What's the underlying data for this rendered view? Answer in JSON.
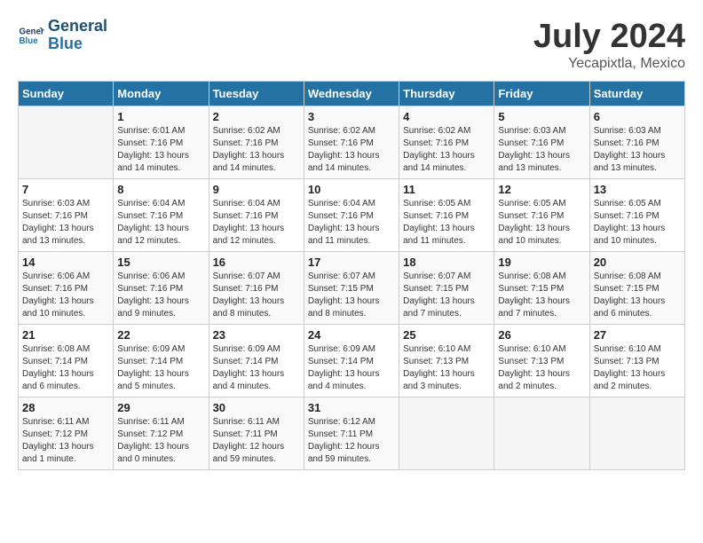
{
  "header": {
    "logo_line1": "General",
    "logo_line2": "Blue",
    "month": "July 2024",
    "location": "Yecapixtla, Mexico"
  },
  "columns": [
    "Sunday",
    "Monday",
    "Tuesday",
    "Wednesday",
    "Thursday",
    "Friday",
    "Saturday"
  ],
  "weeks": [
    [
      {
        "day": "",
        "info": ""
      },
      {
        "day": "1",
        "info": "Sunrise: 6:01 AM\nSunset: 7:16 PM\nDaylight: 13 hours\nand 14 minutes."
      },
      {
        "day": "2",
        "info": "Sunrise: 6:02 AM\nSunset: 7:16 PM\nDaylight: 13 hours\nand 14 minutes."
      },
      {
        "day": "3",
        "info": "Sunrise: 6:02 AM\nSunset: 7:16 PM\nDaylight: 13 hours\nand 14 minutes."
      },
      {
        "day": "4",
        "info": "Sunrise: 6:02 AM\nSunset: 7:16 PM\nDaylight: 13 hours\nand 14 minutes."
      },
      {
        "day": "5",
        "info": "Sunrise: 6:03 AM\nSunset: 7:16 PM\nDaylight: 13 hours\nand 13 minutes."
      },
      {
        "day": "6",
        "info": "Sunrise: 6:03 AM\nSunset: 7:16 PM\nDaylight: 13 hours\nand 13 minutes."
      }
    ],
    [
      {
        "day": "7",
        "info": "Sunrise: 6:03 AM\nSunset: 7:16 PM\nDaylight: 13 hours\nand 13 minutes."
      },
      {
        "day": "8",
        "info": "Sunrise: 6:04 AM\nSunset: 7:16 PM\nDaylight: 13 hours\nand 12 minutes."
      },
      {
        "day": "9",
        "info": "Sunrise: 6:04 AM\nSunset: 7:16 PM\nDaylight: 13 hours\nand 12 minutes."
      },
      {
        "day": "10",
        "info": "Sunrise: 6:04 AM\nSunset: 7:16 PM\nDaylight: 13 hours\nand 11 minutes."
      },
      {
        "day": "11",
        "info": "Sunrise: 6:05 AM\nSunset: 7:16 PM\nDaylight: 13 hours\nand 11 minutes."
      },
      {
        "day": "12",
        "info": "Sunrise: 6:05 AM\nSunset: 7:16 PM\nDaylight: 13 hours\nand 10 minutes."
      },
      {
        "day": "13",
        "info": "Sunrise: 6:05 AM\nSunset: 7:16 PM\nDaylight: 13 hours\nand 10 minutes."
      }
    ],
    [
      {
        "day": "14",
        "info": "Sunrise: 6:06 AM\nSunset: 7:16 PM\nDaylight: 13 hours\nand 10 minutes."
      },
      {
        "day": "15",
        "info": "Sunrise: 6:06 AM\nSunset: 7:16 PM\nDaylight: 13 hours\nand 9 minutes."
      },
      {
        "day": "16",
        "info": "Sunrise: 6:07 AM\nSunset: 7:16 PM\nDaylight: 13 hours\nand 8 minutes."
      },
      {
        "day": "17",
        "info": "Sunrise: 6:07 AM\nSunset: 7:15 PM\nDaylight: 13 hours\nand 8 minutes."
      },
      {
        "day": "18",
        "info": "Sunrise: 6:07 AM\nSunset: 7:15 PM\nDaylight: 13 hours\nand 7 minutes."
      },
      {
        "day": "19",
        "info": "Sunrise: 6:08 AM\nSunset: 7:15 PM\nDaylight: 13 hours\nand 7 minutes."
      },
      {
        "day": "20",
        "info": "Sunrise: 6:08 AM\nSunset: 7:15 PM\nDaylight: 13 hours\nand 6 minutes."
      }
    ],
    [
      {
        "day": "21",
        "info": "Sunrise: 6:08 AM\nSunset: 7:14 PM\nDaylight: 13 hours\nand 6 minutes."
      },
      {
        "day": "22",
        "info": "Sunrise: 6:09 AM\nSunset: 7:14 PM\nDaylight: 13 hours\nand 5 minutes."
      },
      {
        "day": "23",
        "info": "Sunrise: 6:09 AM\nSunset: 7:14 PM\nDaylight: 13 hours\nand 4 minutes."
      },
      {
        "day": "24",
        "info": "Sunrise: 6:09 AM\nSunset: 7:14 PM\nDaylight: 13 hours\nand 4 minutes."
      },
      {
        "day": "25",
        "info": "Sunrise: 6:10 AM\nSunset: 7:13 PM\nDaylight: 13 hours\nand 3 minutes."
      },
      {
        "day": "26",
        "info": "Sunrise: 6:10 AM\nSunset: 7:13 PM\nDaylight: 13 hours\nand 2 minutes."
      },
      {
        "day": "27",
        "info": "Sunrise: 6:10 AM\nSunset: 7:13 PM\nDaylight: 13 hours\nand 2 minutes."
      }
    ],
    [
      {
        "day": "28",
        "info": "Sunrise: 6:11 AM\nSunset: 7:12 PM\nDaylight: 13 hours\nand 1 minute."
      },
      {
        "day": "29",
        "info": "Sunrise: 6:11 AM\nSunset: 7:12 PM\nDaylight: 13 hours\nand 0 minutes."
      },
      {
        "day": "30",
        "info": "Sunrise: 6:11 AM\nSunset: 7:11 PM\nDaylight: 12 hours\nand 59 minutes."
      },
      {
        "day": "31",
        "info": "Sunrise: 6:12 AM\nSunset: 7:11 PM\nDaylight: 12 hours\nand 59 minutes."
      },
      {
        "day": "",
        "info": ""
      },
      {
        "day": "",
        "info": ""
      },
      {
        "day": "",
        "info": ""
      }
    ]
  ]
}
